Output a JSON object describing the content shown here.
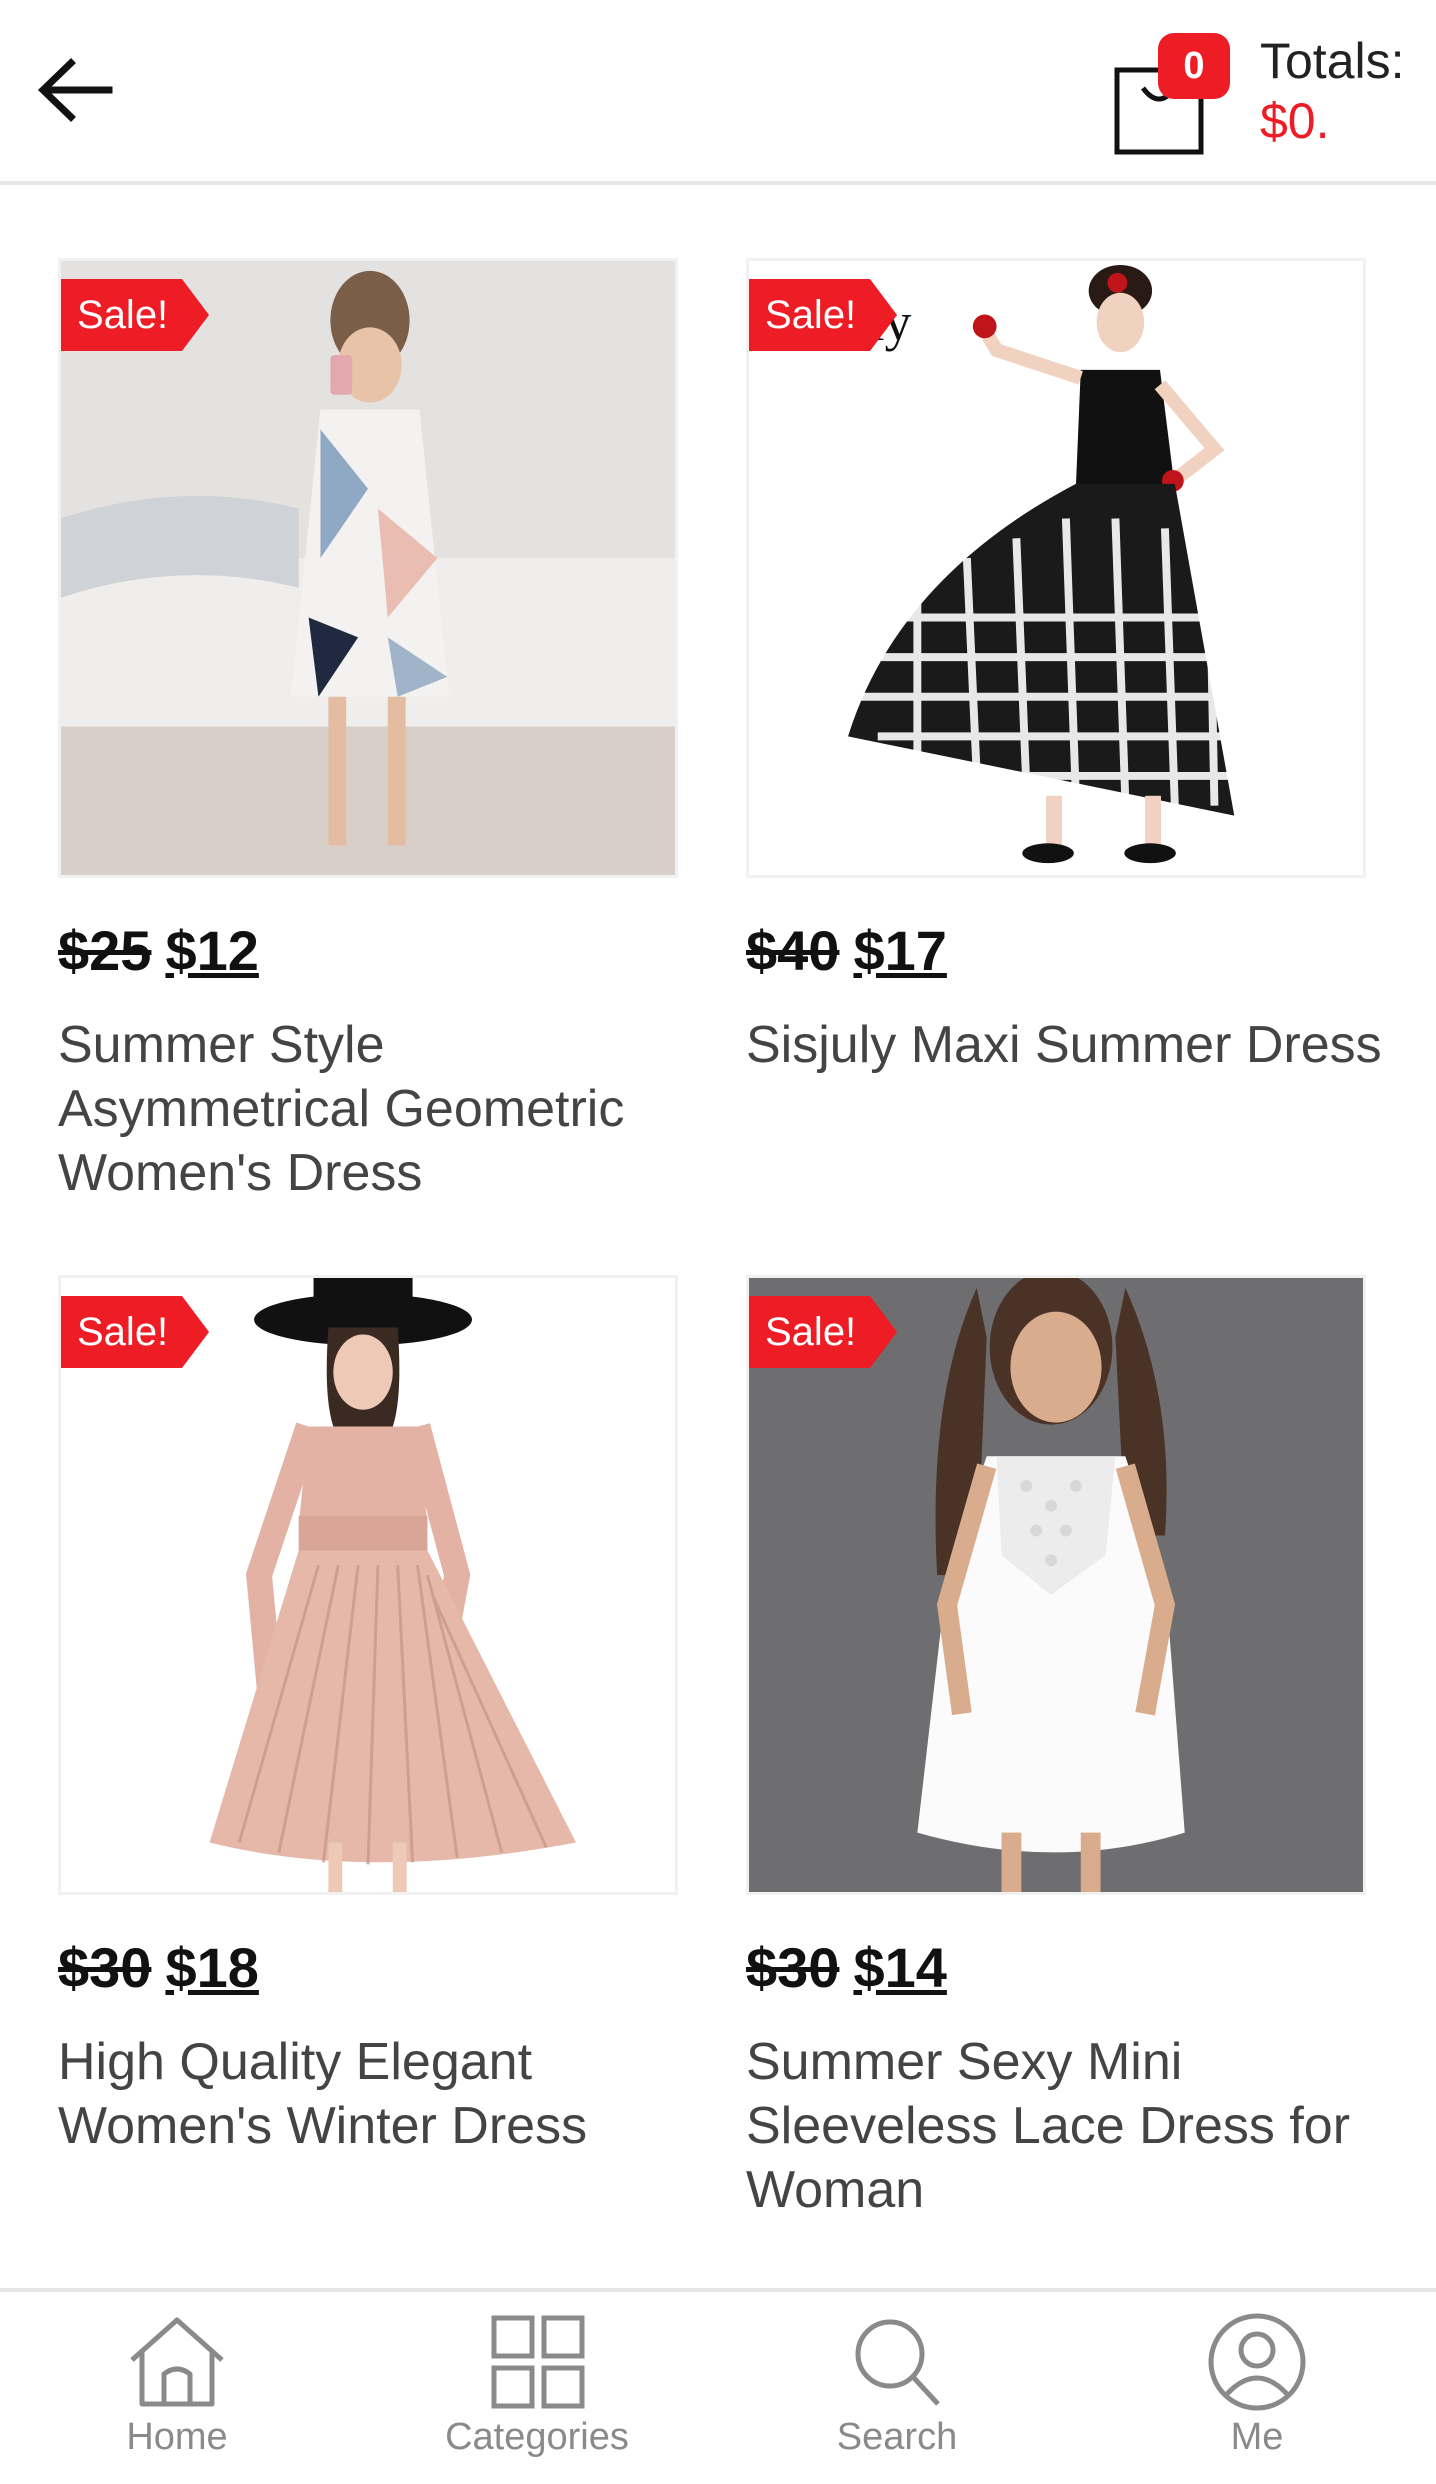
{
  "header": {
    "cart_count": "0",
    "totals_label": "Totals:",
    "totals_value": "$0."
  },
  "products": [
    {
      "sale": "Sale!",
      "old_price": "$25",
      "new_price": "$12",
      "name": "Summer Style Asymmetrical Geometric Women's Dress"
    },
    {
      "sale": "Sale!",
      "old_price": "$40",
      "new_price": "$17",
      "name": "Sisjuly Maxi Summer Dress"
    },
    {
      "sale": "Sale!",
      "old_price": "$30",
      "new_price": "$18",
      "name": "High Quality Elegant Women's Winter Dress"
    },
    {
      "sale": "Sale!",
      "old_price": "$30",
      "new_price": "$14",
      "name": "Summer Sexy Mini Sleeveless Lace Dress for Woman"
    }
  ],
  "nav": {
    "home": "Home",
    "categories": "Categories",
    "search": "Search",
    "me": "Me"
  },
  "colors": {
    "accent": "#ee1c25",
    "text": "#222222",
    "muted": "#8a8a8a"
  }
}
